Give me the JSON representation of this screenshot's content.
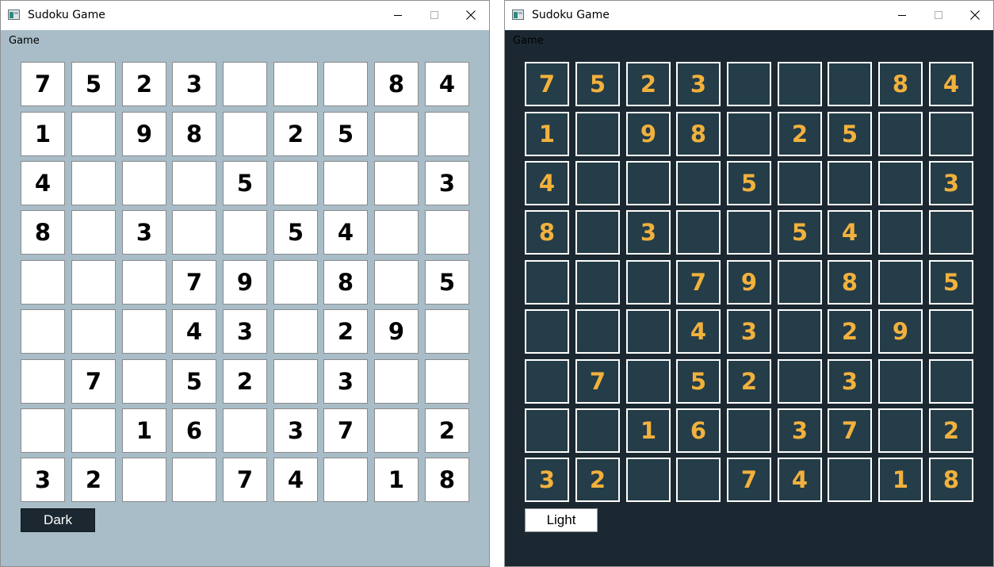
{
  "windows": [
    {
      "id": "light",
      "title": "Sudoku Game",
      "menu": "Game",
      "theme_button": "Dark"
    },
    {
      "id": "dark",
      "title": "Sudoku Game",
      "menu": "Game",
      "theme_button": "Light"
    }
  ],
  "colors": {
    "light_background": "#a8bdc8",
    "light_cell": "#ffffff",
    "light_digit": "#000000",
    "dark_background": "#1b2831",
    "dark_cell": "#243d48",
    "dark_digit": "#f2b13d"
  },
  "window_controls": [
    "minimize-icon",
    "maximize-icon",
    "close-icon"
  ],
  "board": [
    [
      "7",
      "5",
      "2",
      "3",
      "",
      "",
      "",
      "8",
      "4"
    ],
    [
      "1",
      "",
      "9",
      "8",
      "",
      "2",
      "5",
      "",
      ""
    ],
    [
      "4",
      "",
      "",
      "",
      "5",
      "",
      "",
      "",
      "3"
    ],
    [
      "8",
      "",
      "3",
      "",
      "",
      "5",
      "4",
      "",
      ""
    ],
    [
      "",
      "",
      "",
      "7",
      "9",
      "",
      "8",
      "",
      "5"
    ],
    [
      "",
      "",
      "",
      "4",
      "3",
      "",
      "2",
      "9",
      ""
    ],
    [
      "",
      "7",
      "",
      "5",
      "2",
      "",
      "3",
      "",
      ""
    ],
    [
      "",
      "",
      "1",
      "6",
      "",
      "3",
      "7",
      "",
      "2"
    ],
    [
      "3",
      "2",
      "",
      "",
      "7",
      "4",
      "",
      "1",
      "8"
    ]
  ]
}
